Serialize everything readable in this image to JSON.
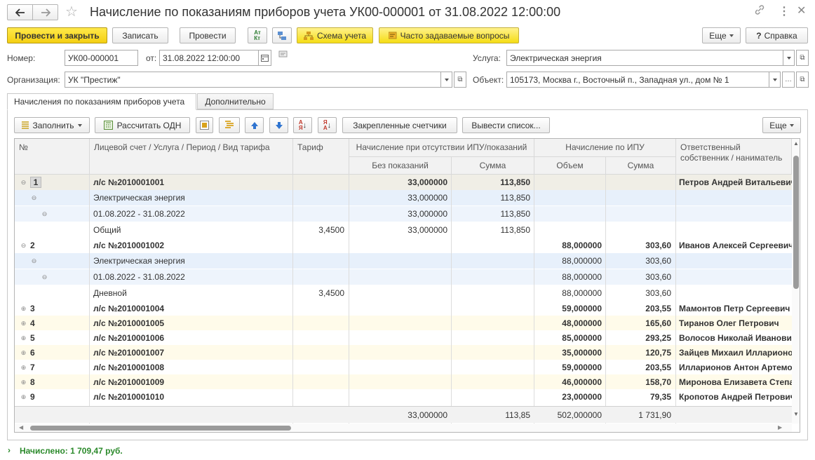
{
  "window": {
    "title": "Начисление по показаниям приборов учета УК00-000001 от 31.08.2022 12:00:00"
  },
  "toolbar": {
    "post_close": "Провести и закрыть",
    "save": "Записать",
    "post": "Провести",
    "scheme": "Схема учета",
    "faq": "Часто задаваемые вопросы",
    "more": "Еще",
    "help": "Справка",
    "dtkt": "Дт/Кт"
  },
  "form": {
    "number_label": "Номер:",
    "number": "УК00-000001",
    "from_label": "от:",
    "date": "31.08.2022 12:00:00",
    "org_label": "Организация:",
    "org": "УК \"Престиж\"",
    "service_label": "Услуга:",
    "service": "Электрическая энергия",
    "object_label": "Объект:",
    "object": "105173, Москва г., Восточный п., Западная ул., дом № 1"
  },
  "tabs": [
    {
      "label": "Начисления по показаниям приборов учета"
    },
    {
      "label": "Дополнительно"
    }
  ],
  "grid_toolbar": {
    "fill": "Заполнить",
    "calc_odn": "Рассчитать ОДН",
    "pinned": "Закрепленные счетчики",
    "output_list": "Вывести список...",
    "more": "Еще"
  },
  "columns": {
    "num": "№",
    "account": "Лицевой счет / Услуга / Период / Вид тарифа",
    "tariff": "Тариф",
    "no_ipu": "Начисление при отсутствии ИПУ/показаний",
    "no_readings": "Без показаний",
    "sum": "Сумма",
    "ipu": "Начисление по ИПУ",
    "volume": "Объем",
    "sum2": "Сумма",
    "owner": "Ответственный собственник / наниматель"
  },
  "rows": [
    {
      "num": "1",
      "account": "л/с №2010001001",
      "tariff": "",
      "no_readings": "33,000000",
      "sum1": "113,850",
      "volume": "",
      "sum2": "",
      "owner": "Петров Андрей Витальевич"
    },
    {
      "num": "",
      "account": "Электрическая энергия",
      "tariff": "",
      "no_readings": "33,000000",
      "sum1": "113,850",
      "volume": "",
      "sum2": "",
      "owner": ""
    },
    {
      "num": "",
      "account": "01.08.2022 - 31.08.2022",
      "tariff": "",
      "no_readings": "33,000000",
      "sum1": "113,850",
      "volume": "",
      "sum2": "",
      "owner": ""
    },
    {
      "num": "",
      "account": "Общий",
      "tariff": "3,4500",
      "no_readings": "33,000000",
      "sum1": "113,850",
      "volume": "",
      "sum2": "",
      "owner": ""
    },
    {
      "num": "2",
      "account": "л/с №2010001002",
      "tariff": "",
      "no_readings": "",
      "sum1": "",
      "volume": "88,000000",
      "sum2": "303,60",
      "owner": "Иванов Алексей Сергеевич"
    },
    {
      "num": "",
      "account": "Электрическая энергия",
      "tariff": "",
      "no_readings": "",
      "sum1": "",
      "volume": "88,000000",
      "sum2": "303,60",
      "owner": ""
    },
    {
      "num": "",
      "account": "01.08.2022 - 31.08.2022",
      "tariff": "",
      "no_readings": "",
      "sum1": "",
      "volume": "88,000000",
      "sum2": "303,60",
      "owner": ""
    },
    {
      "num": "",
      "account": "Дневной",
      "tariff": "3,4500",
      "no_readings": "",
      "sum1": "",
      "volume": "88,000000",
      "sum2": "303,60",
      "owner": ""
    },
    {
      "num": "3",
      "account": "л/с №2010001004",
      "tariff": "",
      "no_readings": "",
      "sum1": "",
      "volume": "59,000000",
      "sum2": "203,55",
      "owner": "Мамонтов Петр Сергеевич"
    },
    {
      "num": "4",
      "account": "л/с №2010001005",
      "tariff": "",
      "no_readings": "",
      "sum1": "",
      "volume": "48,000000",
      "sum2": "165,60",
      "owner": "Тиранов Олег Петрович"
    },
    {
      "num": "5",
      "account": "л/с №2010001006",
      "tariff": "",
      "no_readings": "",
      "sum1": "",
      "volume": "85,000000",
      "sum2": "293,25",
      "owner": "Волосов Николай Иванович"
    },
    {
      "num": "6",
      "account": "л/с №2010001007",
      "tariff": "",
      "no_readings": "",
      "sum1": "",
      "volume": "35,000000",
      "sum2": "120,75",
      "owner": "Зайцев Михаил Илларионович"
    },
    {
      "num": "7",
      "account": "л/с №2010001008",
      "tariff": "",
      "no_readings": "",
      "sum1": "",
      "volume": "59,000000",
      "sum2": "203,55",
      "owner": "Илларионов Антон Артемович"
    },
    {
      "num": "8",
      "account": "л/с №2010001009",
      "tariff": "",
      "no_readings": "",
      "sum1": "",
      "volume": "46,000000",
      "sum2": "158,70",
      "owner": "Миронова Елизавета Степановна"
    },
    {
      "num": "9",
      "account": "л/с №2010001010",
      "tariff": "",
      "no_readings": "",
      "sum1": "",
      "volume": "23,000000",
      "sum2": "79,35",
      "owner": "Кропотов Андрей Петрович"
    }
  ],
  "totals": {
    "no_readings": "33,000000",
    "sum1": "113,85",
    "volume": "502,000000",
    "sum2": "1 731,90"
  },
  "status": {
    "accrued": "Начислено: 1 709,47 руб."
  },
  "colors": {
    "accent_yellow": "#f5dd14",
    "selected_row": "#fff7d6",
    "child_row": "#e7f0fb",
    "status_green": "#2b8a2b"
  }
}
